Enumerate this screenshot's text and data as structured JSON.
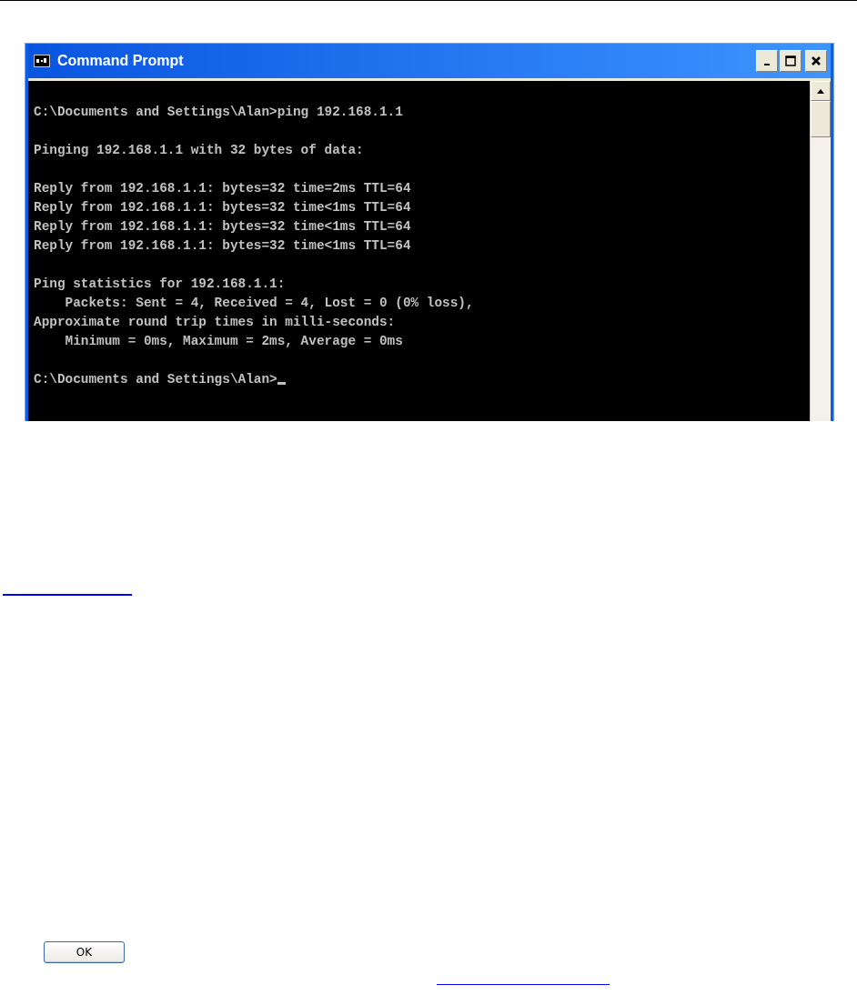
{
  "window": {
    "title": "Command Prompt"
  },
  "console": {
    "blocks": [
      [
        "C:\\Documents and Settings\\Alan>ping 192.168.1.1"
      ],
      [
        "Pinging 192.168.1.1 with 32 bytes of data:"
      ],
      [
        "Reply from 192.168.1.1: bytes=32 time=2ms TTL=64",
        "Reply from 192.168.1.1: bytes=32 time<1ms TTL=64",
        "Reply from 192.168.1.1: bytes=32 time<1ms TTL=64",
        "Reply from 192.168.1.1: bytes=32 time<1ms TTL=64"
      ],
      [
        "Ping statistics for 192.168.1.1:",
        "    Packets: Sent = 4, Received = 4, Lost = 0 (0% loss),",
        "Approximate round trip times in milli-seconds:",
        "    Minimum = 0ms, Maximum = 2ms, Average = 0ms"
      ],
      [
        "C:\\Documents and Settings\\Alan>"
      ]
    ],
    "cursor": true
  },
  "buttons": [
    {
      "label": "OK"
    }
  ]
}
